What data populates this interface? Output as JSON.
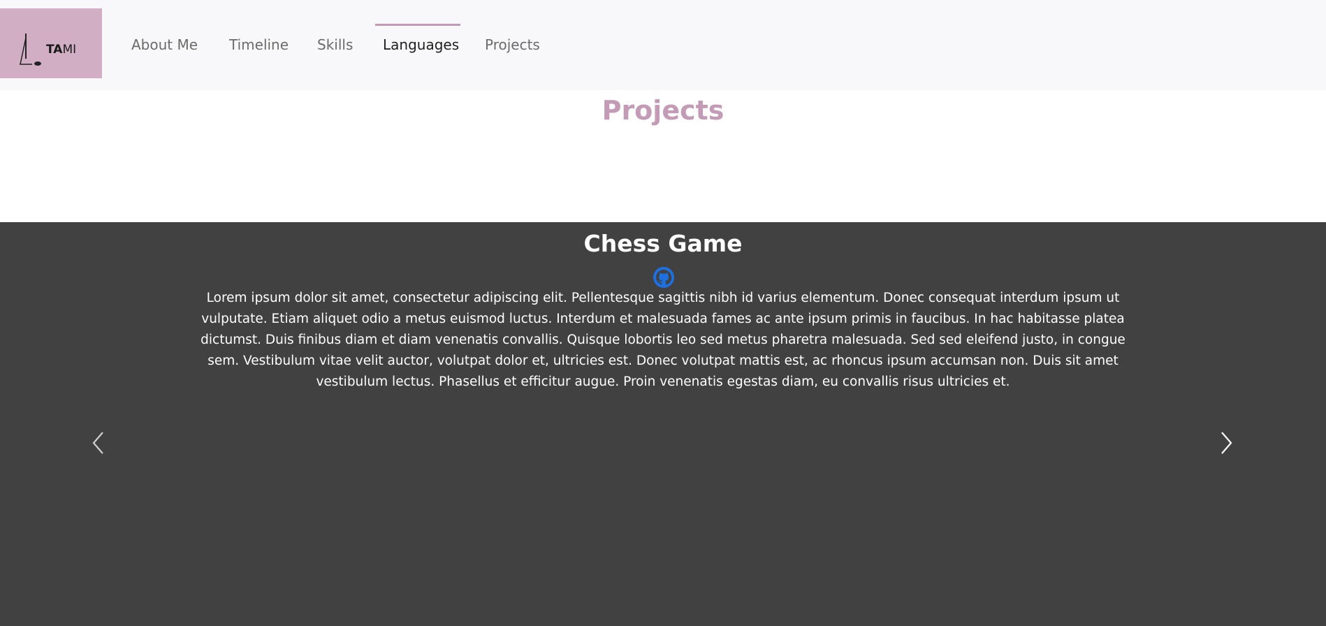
{
  "logo": {
    "text_bold": "TA",
    "text_regular": "MI"
  },
  "nav": {
    "items": [
      {
        "label": "About Me"
      },
      {
        "label": "Timeline"
      },
      {
        "label": "Skills"
      },
      {
        "label": "Languages",
        "active": true
      },
      {
        "label": "Projects"
      }
    ]
  },
  "section": {
    "title": "Projects"
  },
  "carousel": {
    "slide": {
      "title": "Chess Game",
      "link_icon": "github-icon",
      "description": "Lorem ipsum dolor sit amet, consectetur adipiscing elit. Pellentesque sagittis nibh id varius elementum. Donec consequat interdum ipsum ut vulputate. Etiam aliquet odio a metus euismod luctus. Interdum et malesuada fames ac ante ipsum primis in faucibus. In hac habitasse platea dictumst. Duis finibus diam et diam venenatis convallis. Quisque lobortis leo sed metus pharetra malesuada. Sed sed eleifend justo, in congue sem. Vestibulum vitae velit auctor, volutpat dolor et, ultricies est. Donec volutpat mattis est, ac rhoncus ipsum accumsan non. Duis sit amet vestibulum lectus. Phasellus et efficitur augue. Proin venenatis egestas diam, eu convallis risus ultricies et."
    },
    "prev_icon": "chevron-left-icon",
    "next_icon": "chevron-right-icon"
  },
  "colors": {
    "accent": "#c49bb6",
    "logo_bg": "#d1aec4",
    "nav_bg": "#f8f8fa",
    "carousel_bg": "#414141",
    "github_blue": "#1e6fe0"
  }
}
